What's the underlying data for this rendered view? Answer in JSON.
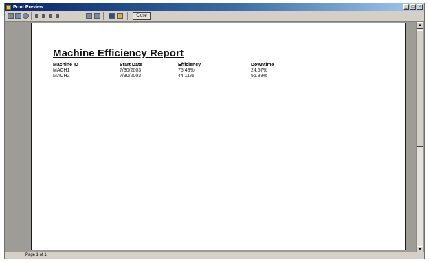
{
  "window": {
    "title": "Print Preview",
    "minimize_glyph": "_",
    "maximize_glyph": "□",
    "close_glyph": "×"
  },
  "toolbar": {
    "close_label": "Close",
    "icons": [
      "print-icon",
      "page-setup-icon",
      "zoom-icon",
      "first-page-icon",
      "previous-page-icon",
      "next-page-icon",
      "last-page-icon",
      "export-icon",
      "email-icon",
      "save-icon",
      "open-icon"
    ]
  },
  "report": {
    "title": "Machine Efficiency Report",
    "columns": [
      "Machine ID",
      "Start Date",
      "Efficiency",
      "Downtime"
    ],
    "rows": [
      [
        "MACH1",
        "7/30/2003",
        "75.43%",
        "24.57%"
      ],
      [
        "MACH2",
        "7/30/2003",
        "44.11%",
        "55.89%"
      ]
    ]
  },
  "scrollbar": {
    "up_glyph": "▲",
    "down_glyph": "▼"
  },
  "status": {
    "page_text": "Page 1 of 1"
  }
}
